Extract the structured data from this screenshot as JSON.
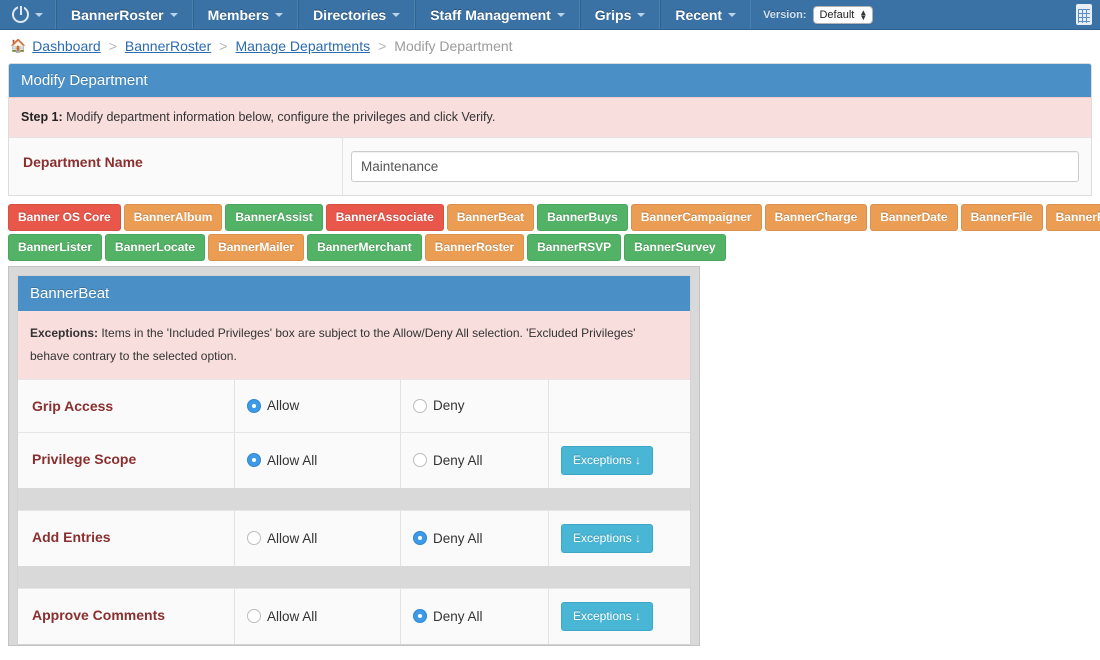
{
  "navbar": {
    "power_icon": "power-icon",
    "items": [
      {
        "label": "BannerRoster",
        "caret": true
      },
      {
        "label": "Members",
        "caret": true
      },
      {
        "label": "Directories",
        "caret": true
      },
      {
        "label": "Staff Management",
        "caret": true
      },
      {
        "label": "Grips",
        "caret": true
      },
      {
        "label": "Recent",
        "caret": true
      }
    ],
    "version_label": "Version:",
    "version_value": "Default",
    "right_icon": "clipboard-icon"
  },
  "breadcrumb": {
    "home_icon": "home-icon",
    "items": [
      {
        "label": "Dashboard",
        "link": true
      },
      {
        "label": "BannerRoster",
        "link": true
      },
      {
        "label": "Manage Departments",
        "link": true
      },
      {
        "label": "Modify Department",
        "link": false
      }
    ],
    "separator": ">"
  },
  "panel": {
    "title": "Modify Department",
    "step_bold": "Step 1:",
    "step_text": " Modify department information below, configure the privileges and click Verify.",
    "department_name_label": "Department Name",
    "department_name_value": "Maintenance",
    "department_name_placeholder": "Department Name"
  },
  "tabs": {
    "row1": [
      {
        "label": "Banner OS Core",
        "color": "red"
      },
      {
        "label": "BannerAlbum",
        "color": "orange"
      },
      {
        "label": "BannerAssist",
        "color": "green"
      },
      {
        "label": "BannerAssociate",
        "color": "red"
      },
      {
        "label": "BannerBeat",
        "color": "orange"
      },
      {
        "label": "BannerBuys",
        "color": "green"
      },
      {
        "label": "BannerCampaigner",
        "color": "orange"
      },
      {
        "label": "BannerCharge",
        "color": "orange"
      },
      {
        "label": "BannerDate",
        "color": "orange"
      },
      {
        "label": "BannerFile",
        "color": "orange"
      },
      {
        "label": "BannerForms",
        "color": "orange"
      }
    ],
    "row2": [
      {
        "label": "BannerLister",
        "color": "green"
      },
      {
        "label": "BannerLocate",
        "color": "green"
      },
      {
        "label": "BannerMailer",
        "color": "orange"
      },
      {
        "label": "BannerMerchant",
        "color": "green"
      },
      {
        "label": "BannerRoster",
        "color": "orange"
      },
      {
        "label": "BannerRSVP",
        "color": "green"
      },
      {
        "label": "BannerSurvey",
        "color": "green"
      }
    ]
  },
  "privileges": {
    "title": "BannerBeat",
    "note_bold": "Exceptions:",
    "note_text": " Items in the 'Included Privileges' box are subject to the Allow/Deny All selection. 'Excluded Privileges' behave contrary to the selected option.",
    "exceptions_button_label": "Exceptions ↓",
    "rows": [
      {
        "name": "Grip Access",
        "opt1_label": "Allow",
        "opt1_selected": true,
        "opt2_label": "Deny",
        "opt2_selected": false,
        "has_exceptions": false
      },
      {
        "name": "Privilege Scope",
        "opt1_label": "Allow All",
        "opt1_selected": true,
        "opt2_label": "Deny All",
        "opt2_selected": false,
        "has_exceptions": true
      },
      {
        "name": "Add Entries",
        "opt1_label": "Allow All",
        "opt1_selected": false,
        "opt2_label": "Deny All",
        "opt2_selected": true,
        "has_exceptions": true
      },
      {
        "name": "Approve Comments",
        "opt1_label": "Allow All",
        "opt1_selected": false,
        "opt2_label": "Deny All",
        "opt2_selected": true,
        "has_exceptions": true
      }
    ]
  },
  "colors": {
    "nav_blue": "#3a72a6",
    "panel_blue": "#4a90c6",
    "alert_pink": "#f9dede",
    "tab_red": "#e8574a",
    "tab_orange": "#eb9d53",
    "tab_green": "#52b265",
    "exceptions_teal": "#49b6d6",
    "label_maroon": "#8a2f2f",
    "radio_on": "#3d9ae8"
  }
}
